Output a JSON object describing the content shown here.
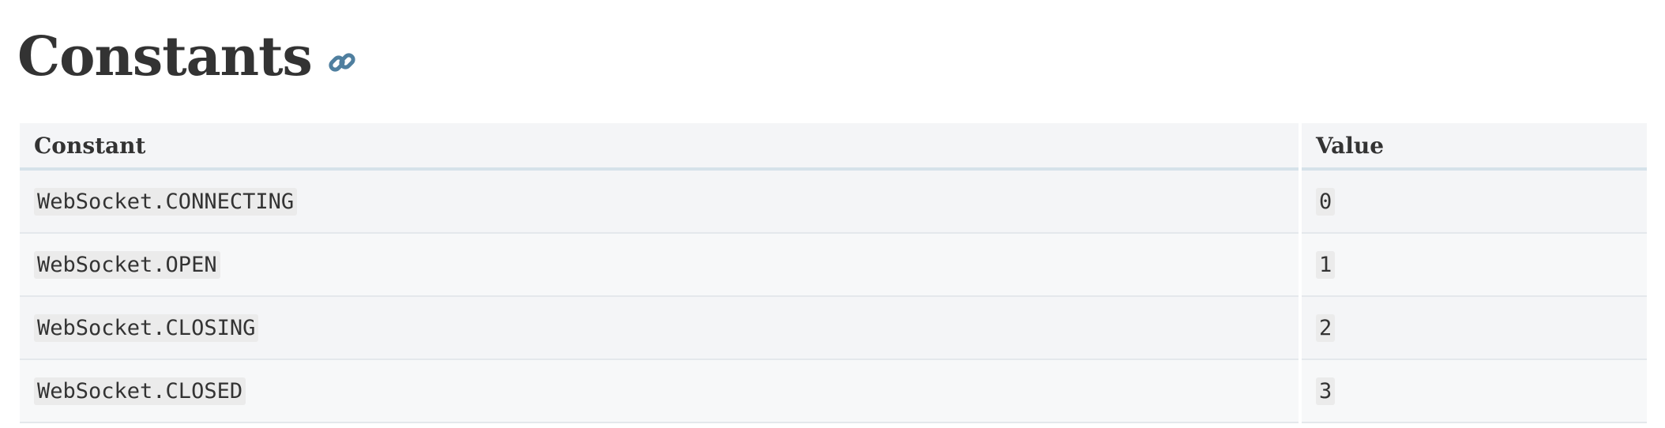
{
  "heading": {
    "title": "Constants",
    "link_icon": "link-icon"
  },
  "table": {
    "headers": [
      "Constant",
      "Value"
    ],
    "rows": [
      {
        "constant": "WebSocket.CONNECTING",
        "value": "0"
      },
      {
        "constant": "WebSocket.OPEN",
        "value": "1"
      },
      {
        "constant": "WebSocket.CLOSING",
        "value": "2"
      },
      {
        "constant": "WebSocket.CLOSED",
        "value": "3"
      }
    ]
  },
  "colors": {
    "text": "#333333",
    "link_icon": "#4f7f9f",
    "header_bg": "#f4f5f7",
    "header_border": "#d6e2ea",
    "code_bg": "#ebebeb"
  }
}
